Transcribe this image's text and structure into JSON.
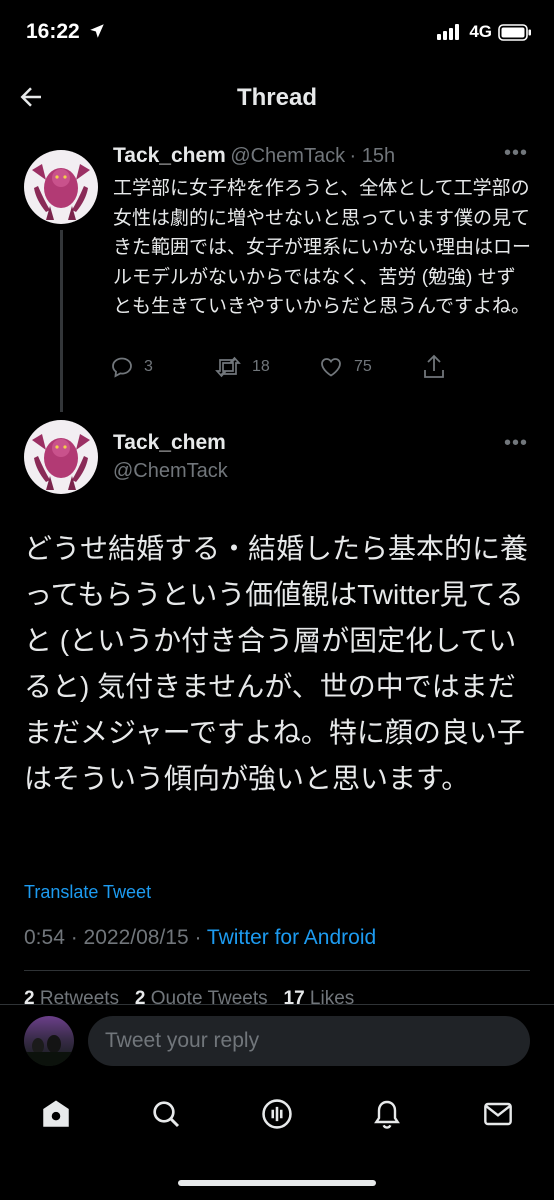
{
  "status_bar": {
    "time": "16:22",
    "network": "4G"
  },
  "header": {
    "title": "Thread"
  },
  "parent_tweet": {
    "name": "Tack_chem",
    "handle": "@ChemTack",
    "time_ago": "· 15h",
    "text": "工学部に女子枠を作ろうと、全体として工学部の女性は劇的に増やせないと思っています僕の見てきた範囲では、女子が理系にいかない理由はロールモデルがないからではなく、苦労 (勉強) せずとも生きていきやすいからだと思うんですよね。",
    "replies": "3",
    "retweets": "18",
    "likes": "75"
  },
  "main_tweet": {
    "name": "Tack_chem",
    "handle": "@ChemTack",
    "text": "どうせ結婚する・結婚したら基本的に養ってもらうという価値観はTwitter見てると (というか付き合う層が固定化していると) 気付きませんが、世の中ではまだまだメジャーですよね。特に顔の良い子はそういう傾向が強いと思います。",
    "translate_label": "Translate Tweet",
    "timestamp": "0:54 · 2022/08/15 · ",
    "source": "Twitter for Android",
    "retweets_count": "2",
    "retweets_label": "Retweets",
    "quote_count": "2",
    "quote_label": "Quote Tweets",
    "likes_count": "17",
    "likes_label": "Likes"
  },
  "reply_box": {
    "placeholder": "Tweet your reply"
  },
  "tabs": [
    "home-icon",
    "search-icon",
    "spaces-icon",
    "notifications-icon",
    "messages-icon"
  ],
  "colors": {
    "background": "#000000",
    "accent": "#1d9bf0",
    "secondary_text": "#71767b"
  }
}
